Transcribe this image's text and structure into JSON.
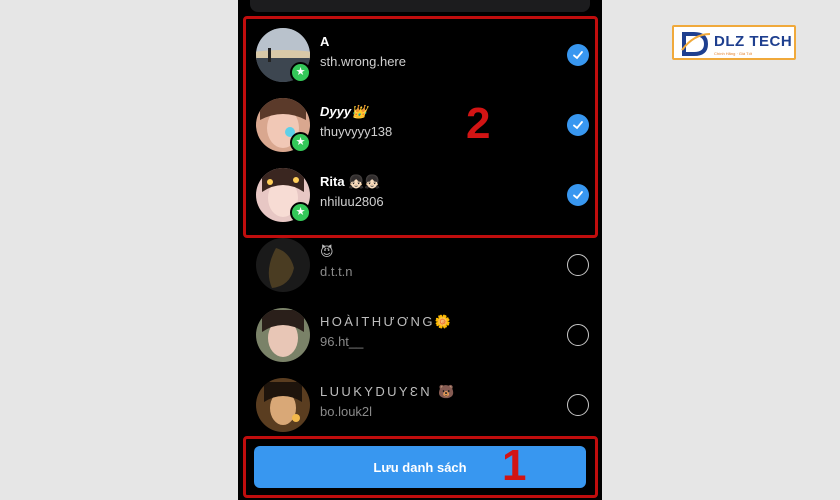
{
  "list": {
    "contacts": [
      {
        "name": "A",
        "username": "sth.wrong.here",
        "selected": true,
        "favorite": true
      },
      {
        "name": "Dyyy👑",
        "username": "thuyvyyy138",
        "selected": true,
        "favorite": true
      },
      {
        "name": "Rita 👧🏻👧🏻",
        "username": "nhiluu2806",
        "selected": true,
        "favorite": true
      },
      {
        "name": "😈",
        "username": "d.t.t.n",
        "selected": false,
        "favorite": false
      },
      {
        "name": "HOÀITHƯƠNG🌼",
        "username": "96.ht__",
        "selected": false,
        "favorite": false
      },
      {
        "name": "LUUKYDUYƐN 🐻",
        "username": "bo.louk2l",
        "selected": false,
        "favorite": false
      }
    ]
  },
  "save_button": {
    "label": "Lưu danh sách"
  },
  "annotations": {
    "step_1": "1",
    "step_2": "2"
  },
  "logo": {
    "brand": "DLZ TECH",
    "tagline": "Chính Hãng · Giá Tốt",
    "icon": "dlz-tech-logo"
  },
  "icons": {
    "check": "checkmark-icon",
    "star": "star-icon",
    "radio": "empty-radio-icon"
  },
  "colors": {
    "accent": "#3897f0",
    "favorite_badge": "#34c759",
    "annotation": "#c00d0d",
    "background": "#000000"
  }
}
